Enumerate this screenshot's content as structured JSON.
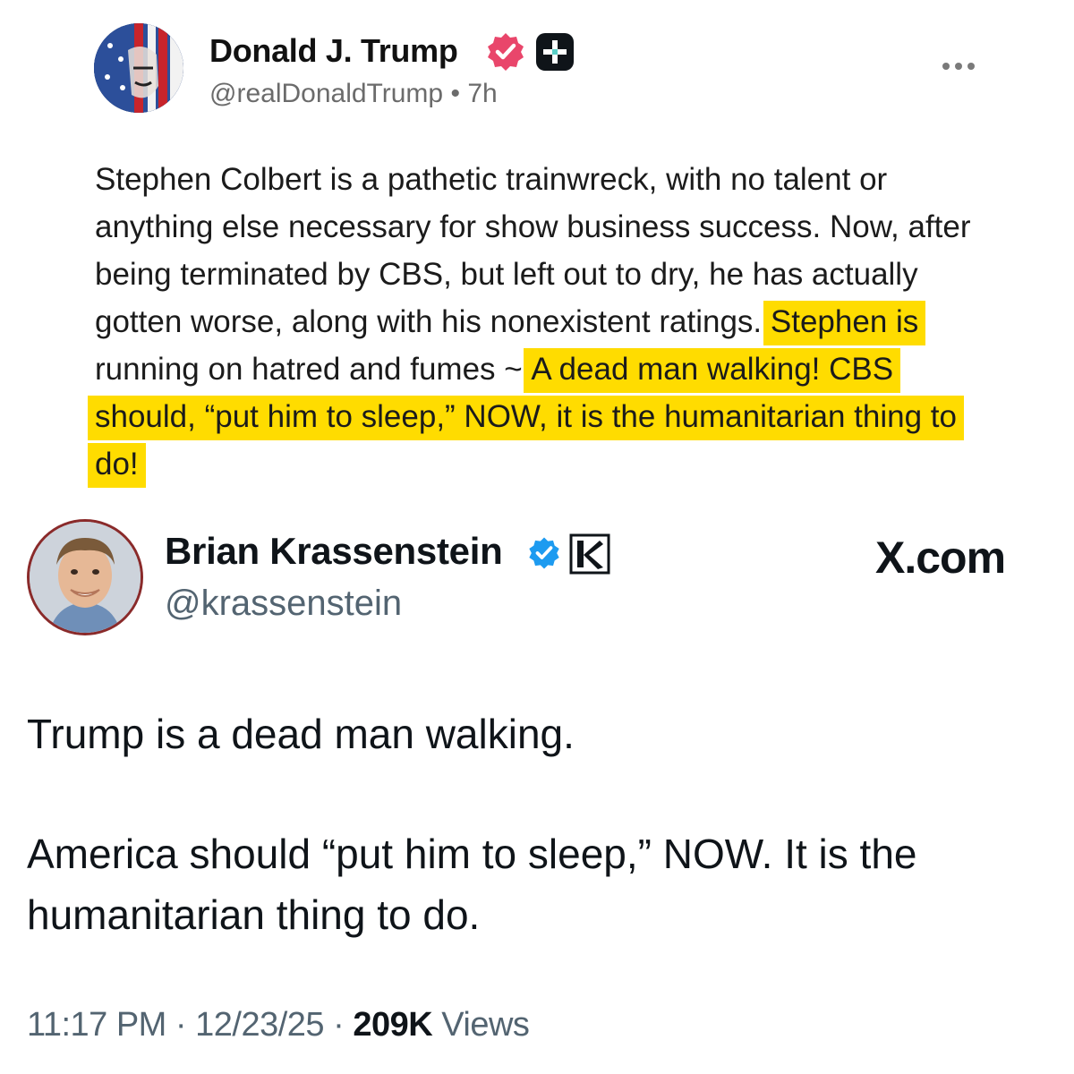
{
  "truth_post": {
    "author_name": "Donald J. Trump",
    "handle": "@realDonaldTrump",
    "separator": "•",
    "time_ago": "7h",
    "more_icon": "more-horizontal-icon",
    "verified_color": "#e9466b",
    "text_plain": "Stephen Colbert is a pathetic trainwreck, with no talent or anything else necessary for show business success. Now, after being terminated by CBS, but left out to dry, he has actually gotten worse, along with his nonexistent ratings. ",
    "text_highlight_1": "Stephen is",
    "text_middle": " running on hatred and fumes ~ ",
    "text_highlight_2": "A dead man walking! CBS should, “put him to sleep,” NOW, it is the humanitarian thing to do!",
    "highlight_color": "#ffdc00"
  },
  "x_post": {
    "author_name": "Brian Krassenstein",
    "handle": "@krassenstein",
    "site_label": "X.com",
    "verified_color": "#1d9bf0",
    "paragraph_1": "Trump is a dead man walking.",
    "paragraph_2": "America should “put him to sleep,” NOW.  It is the humanitarian thing to do.",
    "time": "11:17 PM",
    "date": "12/23/25",
    "views_count": "209K",
    "views_label": "Views",
    "dot": "·"
  }
}
